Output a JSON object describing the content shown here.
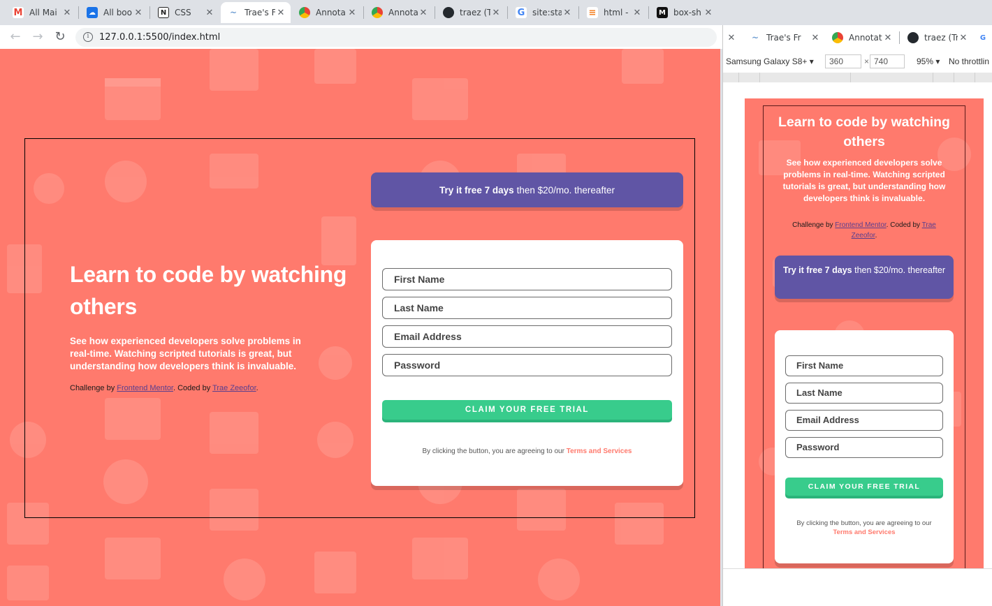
{
  "browser": {
    "tabs": [
      {
        "title": "All Mai",
        "icon": "gmail-icon",
        "color": "#ea4335",
        "glyph": "M"
      },
      {
        "title": "All boo",
        "icon": "cloud-icon",
        "color": "#1a73e8",
        "glyph": "☁"
      },
      {
        "title": "CSS",
        "icon": "notion-icon",
        "color": "#222222",
        "glyph": "N"
      },
      {
        "title": "Trae's F",
        "icon": "page-icon",
        "color": "#9aa0a6",
        "glyph": "~"
      },
      {
        "title": "Annota",
        "icon": "chrome-icon",
        "color": "#34a853",
        "glyph": "●"
      },
      {
        "title": "Annota",
        "icon": "chrome-icon",
        "color": "#34a853",
        "glyph": "●"
      },
      {
        "title": "traez (T",
        "icon": "github-icon",
        "color": "#24292e",
        "glyph": "●"
      },
      {
        "title": "site:sta",
        "icon": "google-icon",
        "color": "#4285f4",
        "glyph": "G"
      },
      {
        "title": "html - (",
        "icon": "stackoverflow-icon",
        "color": "#f48024",
        "glyph": "≡"
      },
      {
        "title": "box-sh",
        "icon": "medium-icon",
        "color": "#111111",
        "glyph": "M"
      }
    ],
    "url": "127.0.0.1:5500/index.html"
  },
  "devtools": {
    "tabs": [
      {
        "title": "Trae's Fr",
        "icon": "page-icon",
        "color": "#9aa0a6",
        "glyph": "~"
      },
      {
        "title": "Annotate",
        "icon": "chrome-icon",
        "color": "#34a853",
        "glyph": "●"
      },
      {
        "title": "traez (Tr",
        "icon": "github-icon",
        "color": "#24292e",
        "glyph": "●"
      }
    ],
    "device": "Samsung Galaxy S8+",
    "width": "360",
    "height": "740",
    "zoom": "95%",
    "throttle": "No throttlin"
  },
  "page": {
    "title": "Learn to code by watching others",
    "description": "See how experienced developers solve problems in real-time. Watching scripted tutorials is great, but understanding how developers think is invaluable.",
    "credit": {
      "prefix": "Challenge by ",
      "link1": "Frontend Mentor",
      "mid": ". Coded by ",
      "link2": "Trae Zeeofor",
      "suffix": "."
    },
    "promo": {
      "bold": "Try it free 7 days",
      "rest": "then $20/mo. thereafter"
    },
    "form": {
      "first_name": "First Name",
      "last_name": "Last Name",
      "email": "Email Address",
      "password": "Password",
      "cta": "CLAIM YOUR FREE TRIAL",
      "terms_prefix": "By clicking the button, you are agreeing to our ",
      "terms_link": "Terms and Services"
    }
  },
  "colors": {
    "background": "#ff7a6d",
    "promo": "#6055a5",
    "cta": "#38cc8c",
    "link": "#5a3e8e"
  }
}
